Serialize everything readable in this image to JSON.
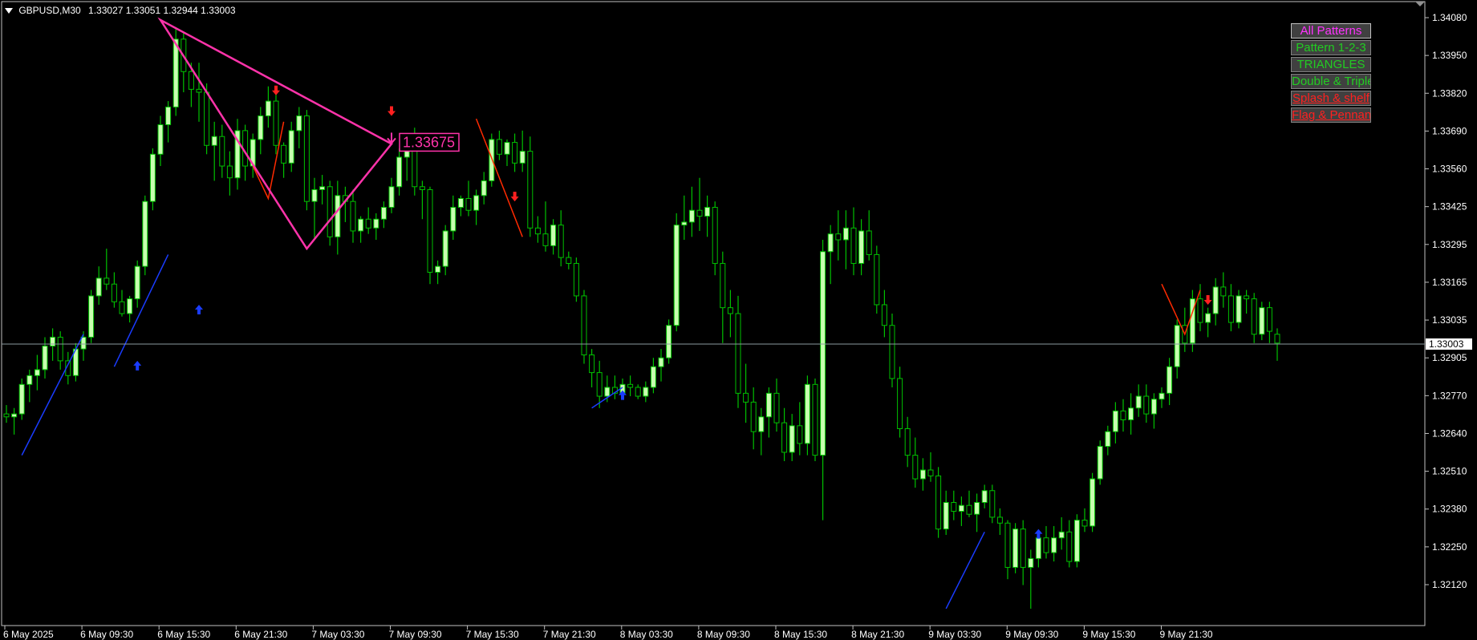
{
  "header": {
    "symbol": "GBPUSD,M30",
    "ohlc": "1.33027 1.33051 1.32944 1.33003"
  },
  "colors": {
    "background": "#000000",
    "axis": "#c0c0c0",
    "wick": "#00c000",
    "bull_body": "#c8ffb0",
    "bear_body": "#000000",
    "pattern": "#ff33aa",
    "zigzag_blue": "#1a3cff",
    "zigzag_red": "#ff2a00",
    "arrow_up": "#1a3cff",
    "arrow_down": "#ff2020",
    "bid_line": "#8c9aa0",
    "button_bg": "#404040"
  },
  "price_axis": {
    "ticks": [
      "1.34080",
      "1.33950",
      "1.33820",
      "1.33690",
      "1.33560",
      "1.33425",
      "1.33295",
      "1.33165",
      "1.33035",
      "1.32905",
      "1.32770",
      "1.32640",
      "1.32510",
      "1.32380",
      "1.32250",
      "1.32120"
    ],
    "current_price": "1.33003"
  },
  "time_axis": {
    "labels": [
      "6 May 2025",
      "6 May 09:30",
      "6 May 15:30",
      "6 May 21:30",
      "7 May 03:30",
      "7 May 09:30",
      "7 May 15:30",
      "7 May 21:30",
      "8 May 03:30",
      "8 May 09:30",
      "8 May 15:30",
      "8 May 21:30",
      "9 May 03:30",
      "9 May 09:30",
      "9 May 15:30",
      "9 May 21:30"
    ]
  },
  "triangle": {
    "label": "1.33675",
    "points": [
      [
        0,
        1.34095
      ],
      [
        19,
        1.3332
      ],
      [
        30,
        1.33675
      ]
    ]
  },
  "panel": {
    "buttons": [
      {
        "label": "All Patterns",
        "color": "#ff33ff",
        "active": true,
        "underline": false
      },
      {
        "label": "Pattern 1-2-3",
        "color": "#22cc22",
        "active": false,
        "underline": false
      },
      {
        "label": "TRIANGLES",
        "color": "#22cc22",
        "active": false,
        "underline": false
      },
      {
        "label": "Double & Triple",
        "color": "#22cc22",
        "active": false,
        "underline": false
      },
      {
        "label": "Splash & shelf",
        "color": "#ff2020",
        "active": false,
        "underline": true
      },
      {
        "label": "Flag & Pennant",
        "color": "#ff2020",
        "active": false,
        "underline": true
      }
    ]
  },
  "chart_data": {
    "type": "candlestick",
    "symbol": "GBPUSD",
    "timeframe": "M30",
    "ylim": [
      1.3207,
      1.3413
    ],
    "candle_start": -20,
    "candles": [
      [
        1.3276,
        1.3279,
        1.3273,
        1.3275
      ],
      [
        1.3275,
        1.3278,
        1.3269,
        1.3276
      ],
      [
        1.3276,
        1.3288,
        1.3274,
        1.3286
      ],
      [
        1.3286,
        1.3291,
        1.328,
        1.3289
      ],
      [
        1.3289,
        1.3296,
        1.3284,
        1.3291
      ],
      [
        1.3291,
        1.3302,
        1.3288,
        1.3299
      ],
      [
        1.3299,
        1.3305,
        1.3294,
        1.3302
      ],
      [
        1.3302,
        1.3304,
        1.3291,
        1.3294
      ],
      [
        1.3294,
        1.3297,
        1.3286,
        1.3289
      ],
      [
        1.3289,
        1.33,
        1.3287,
        1.3298
      ],
      [
        1.3298,
        1.3304,
        1.3294,
        1.3302
      ],
      [
        1.3302,
        1.3318,
        1.33,
        1.3316
      ],
      [
        1.3316,
        1.3326,
        1.3313,
        1.3322
      ],
      [
        1.3322,
        1.3332,
        1.3318,
        1.332
      ],
      [
        1.332,
        1.3324,
        1.3312,
        1.3314
      ],
      [
        1.3314,
        1.3318,
        1.3309,
        1.331
      ],
      [
        1.331,
        1.3316,
        1.3307,
        1.3315
      ],
      [
        1.3315,
        1.3328,
        1.3312,
        1.3326
      ],
      [
        1.3326,
        1.335,
        1.3323,
        1.3348
      ],
      [
        1.3348,
        1.3366,
        1.3345,
        1.3364
      ],
      [
        1.3364,
        1.3377,
        1.336,
        1.3374
      ],
      [
        1.3374,
        1.3382,
        1.3368,
        1.338
      ],
      [
        1.338,
        1.3407,
        1.3377,
        1.3403
      ],
      [
        1.3403,
        1.3405,
        1.3385,
        1.3392
      ],
      [
        1.3392,
        1.3395,
        1.338,
        1.3386
      ],
      [
        1.3386,
        1.3395,
        1.3375,
        1.3385
      ],
      [
        1.3385,
        1.3388,
        1.3364,
        1.3367
      ],
      [
        1.3367,
        1.3375,
        1.3355,
        1.337
      ],
      [
        1.337,
        1.3374,
        1.3356,
        1.336
      ],
      [
        1.336,
        1.3365,
        1.335,
        1.3356
      ],
      [
        1.3356,
        1.3376,
        1.3352,
        1.3372
      ],
      [
        1.3372,
        1.3374,
        1.3355,
        1.336
      ],
      [
        1.336,
        1.3371,
        1.3356,
        1.3369
      ],
      [
        1.3369,
        1.338,
        1.3364,
        1.3377
      ],
      [
        1.3377,
        1.3387,
        1.3373,
        1.3382
      ],
      [
        1.3382,
        1.3385,
        1.3364,
        1.3367
      ],
      [
        1.3367,
        1.3368,
        1.3356,
        1.3361
      ],
      [
        1.3361,
        1.3375,
        1.3358,
        1.3372
      ],
      [
        1.3372,
        1.338,
        1.3366,
        1.3377
      ],
      [
        1.3377,
        1.3379,
        1.3345,
        1.3348
      ],
      [
        1.3348,
        1.3356,
        1.3335,
        1.3352
      ],
      [
        1.3352,
        1.3357,
        1.3347,
        1.3353
      ],
      [
        1.3353,
        1.3355,
        1.3333,
        1.3336
      ],
      [
        1.3336,
        1.3355,
        1.333,
        1.335
      ],
      [
        1.335,
        1.3353,
        1.3341,
        1.3348
      ],
      [
        1.3348,
        1.3352,
        1.3334,
        1.3338
      ],
      [
        1.3338,
        1.3343,
        1.3334,
        1.3342
      ],
      [
        1.3342,
        1.3346,
        1.3337,
        1.3339
      ],
      [
        1.3339,
        1.3344,
        1.3335,
        1.3342
      ],
      [
        1.3342,
        1.3348,
        1.3339,
        1.3346
      ],
      [
        1.3346,
        1.3356,
        1.3344,
        1.3353
      ],
      [
        1.3353,
        1.3366,
        1.335,
        1.3363
      ],
      [
        1.3363,
        1.3368,
        1.3355,
        1.3367
      ],
      [
        1.3367,
        1.3373,
        1.335,
        1.3353
      ],
      [
        1.3353,
        1.3355,
        1.3342,
        1.3352
      ],
      [
        1.3352,
        1.3353,
        1.332,
        1.3324
      ],
      [
        1.3324,
        1.3328,
        1.332,
        1.3326
      ],
      [
        1.3326,
        1.334,
        1.3323,
        1.3338
      ],
      [
        1.3338,
        1.335,
        1.3335,
        1.3346
      ],
      [
        1.3346,
        1.335,
        1.3343,
        1.3349
      ],
      [
        1.3349,
        1.3355,
        1.3343,
        1.3345
      ],
      [
        1.3345,
        1.3352,
        1.334,
        1.335
      ],
      [
        1.335,
        1.3358,
        1.3347,
        1.3355
      ],
      [
        1.3355,
        1.3371,
        1.3353,
        1.3369
      ],
      [
        1.3369,
        1.3372,
        1.3362,
        1.3364
      ],
      [
        1.3364,
        1.3369,
        1.336,
        1.3368
      ],
      [
        1.3368,
        1.3371,
        1.3358,
        1.3361
      ],
      [
        1.3361,
        1.3372,
        1.3358,
        1.3365
      ],
      [
        1.3365,
        1.337,
        1.3336,
        1.3339
      ],
      [
        1.3339,
        1.3343,
        1.3334,
        1.3337
      ],
      [
        1.3337,
        1.3348,
        1.3331,
        1.3333
      ],
      [
        1.3333,
        1.3342,
        1.333,
        1.334
      ],
      [
        1.334,
        1.3345,
        1.3326,
        1.3329
      ],
      [
        1.3329,
        1.3331,
        1.3325,
        1.3327
      ],
      [
        1.3327,
        1.3329,
        1.3314,
        1.3316
      ],
      [
        1.3316,
        1.3318,
        1.3293,
        1.3296
      ],
      [
        1.3296,
        1.3298,
        1.3285,
        1.329
      ],
      [
        1.329,
        1.3294,
        1.3278,
        1.3282
      ],
      [
        1.3282,
        1.3289,
        1.328,
        1.3285
      ],
      [
        1.3285,
        1.3289,
        1.3281,
        1.3283
      ],
      [
        1.3283,
        1.3288,
        1.3281,
        1.3286
      ],
      [
        1.3286,
        1.3289,
        1.3282,
        1.3285
      ],
      [
        1.3285,
        1.3286,
        1.3281,
        1.3282
      ],
      [
        1.3282,
        1.3287,
        1.328,
        1.3285
      ],
      [
        1.3285,
        1.3295,
        1.3283,
        1.3292
      ],
      [
        1.3292,
        1.3298,
        1.3287,
        1.3295
      ],
      [
        1.3295,
        1.3308,
        1.3293,
        1.3306
      ],
      [
        1.3306,
        1.3344,
        1.3304,
        1.334
      ],
      [
        1.334,
        1.335,
        1.3335,
        1.3341
      ],
      [
        1.3341,
        1.3353,
        1.3336,
        1.3345
      ],
      [
        1.3345,
        1.3356,
        1.3338,
        1.3343
      ],
      [
        1.3343,
        1.335,
        1.3336,
        1.3346
      ],
      [
        1.3346,
        1.3348,
        1.3323,
        1.3327
      ],
      [
        1.3327,
        1.3331,
        1.33,
        1.3312
      ],
      [
        1.3312,
        1.3318,
        1.3302,
        1.331
      ],
      [
        1.331,
        1.3316,
        1.3278,
        1.3283
      ],
      [
        1.3283,
        1.3293,
        1.3273,
        1.328
      ],
      [
        1.328,
        1.3285,
        1.3264,
        1.327
      ],
      [
        1.327,
        1.3278,
        1.3262,
        1.3275
      ],
      [
        1.3275,
        1.3285,
        1.3268,
        1.3283
      ],
      [
        1.3283,
        1.3288,
        1.327,
        1.3273
      ],
      [
        1.3273,
        1.3278,
        1.326,
        1.3263
      ],
      [
        1.3263,
        1.3276,
        1.326,
        1.3272
      ],
      [
        1.3272,
        1.328,
        1.3262,
        1.3266
      ],
      [
        1.3266,
        1.3289,
        1.3262,
        1.3286
      ],
      [
        1.3286,
        1.3288,
        1.326,
        1.3262
      ],
      [
        1.3262,
        1.3335,
        1.324,
        1.3331
      ],
      [
        1.3331,
        1.334,
        1.332,
        1.3337
      ],
      [
        1.3337,
        1.3345,
        1.3328,
        1.3335
      ],
      [
        1.3335,
        1.3345,
        1.3325,
        1.3339
      ],
      [
        1.3339,
        1.3346,
        1.3323,
        1.3327
      ],
      [
        1.3327,
        1.3342,
        1.3323,
        1.3338
      ],
      [
        1.3338,
        1.3345,
        1.3328,
        1.333
      ],
      [
        1.333,
        1.3333,
        1.331,
        1.3313
      ],
      [
        1.3313,
        1.3318,
        1.3302,
        1.3306
      ],
      [
        1.3306,
        1.331,
        1.3285,
        1.3288
      ],
      [
        1.3288,
        1.3292,
        1.3268,
        1.3271
      ],
      [
        1.3271,
        1.3275,
        1.3258,
        1.3262
      ],
      [
        1.3262,
        1.3268,
        1.3251,
        1.3254
      ],
      [
        1.3254,
        1.3261,
        1.325,
        1.3257
      ],
      [
        1.3257,
        1.3263,
        1.3253,
        1.3255
      ],
      [
        1.3255,
        1.3258,
        1.3234,
        1.3237
      ],
      [
        1.3237,
        1.325,
        1.3235,
        1.3246
      ],
      [
        1.3246,
        1.325,
        1.324,
        1.3243
      ],
      [
        1.3243,
        1.3248,
        1.3238,
        1.3245
      ],
      [
        1.3245,
        1.325,
        1.3241,
        1.3242
      ],
      [
        1.3242,
        1.3249,
        1.3236,
        1.3246
      ],
      [
        1.3246,
        1.3252,
        1.3244,
        1.325
      ],
      [
        1.325,
        1.3252,
        1.3239,
        1.3241
      ],
      [
        1.3241,
        1.3244,
        1.3235,
        1.3239
      ],
      [
        1.3239,
        1.324,
        1.322,
        1.3224
      ],
      [
        1.3224,
        1.3239,
        1.3222,
        1.3237
      ],
      [
        1.3237,
        1.324,
        1.3218,
        1.3224
      ],
      [
        1.3224,
        1.323,
        1.321,
        1.3227
      ],
      [
        1.3227,
        1.3236,
        1.3224,
        1.3234
      ],
      [
        1.3234,
        1.3238,
        1.3227,
        1.3229
      ],
      [
        1.3229,
        1.3238,
        1.3226,
        1.3234
      ],
      [
        1.3234,
        1.3241,
        1.323,
        1.3236
      ],
      [
        1.3236,
        1.324,
        1.3224,
        1.3226
      ],
      [
        1.3226,
        1.3242,
        1.3224,
        1.324
      ],
      [
        1.324,
        1.3244,
        1.3236,
        1.3238
      ],
      [
        1.3238,
        1.3256,
        1.3236,
        1.3254
      ],
      [
        1.3254,
        1.3267,
        1.3252,
        1.3265
      ],
      [
        1.3265,
        1.3272,
        1.3262,
        1.327
      ],
      [
        1.327,
        1.328,
        1.3266,
        1.3277
      ],
      [
        1.3277,
        1.3281,
        1.327,
        1.3274
      ],
      [
        1.3274,
        1.3283,
        1.3269,
        1.3278
      ],
      [
        1.3278,
        1.3286,
        1.3275,
        1.3282
      ],
      [
        1.3282,
        1.3286,
        1.3273,
        1.3276
      ],
      [
        1.3276,
        1.3283,
        1.3271,
        1.3281
      ],
      [
        1.3281,
        1.3285,
        1.3278,
        1.3283
      ],
      [
        1.3283,
        1.3295,
        1.3279,
        1.3292
      ],
      [
        1.3292,
        1.3308,
        1.3288,
        1.3306
      ],
      [
        1.3306,
        1.3312,
        1.3297,
        1.33
      ],
      [
        1.33,
        1.3318,
        1.3297,
        1.3315
      ],
      [
        1.3315,
        1.332,
        1.3304,
        1.3307
      ],
      [
        1.3307,
        1.3312,
        1.3302,
        1.331
      ],
      [
        1.331,
        1.3322,
        1.3306,
        1.3319
      ],
      [
        1.3319,
        1.3324,
        1.3312,
        1.3316
      ],
      [
        1.3316,
        1.332,
        1.3304,
        1.3307
      ],
      [
        1.3307,
        1.3318,
        1.3305,
        1.3316
      ],
      [
        1.3316,
        1.3318,
        1.331,
        1.3315
      ],
      [
        1.3315,
        1.3317,
        1.33,
        1.3303
      ],
      [
        1.3303,
        1.3314,
        1.3301,
        1.3312
      ],
      [
        1.3312,
        1.3314,
        1.33,
        1.3304
      ],
      [
        1.3303,
        1.3305,
        1.3294,
        1.33
      ]
    ]
  },
  "arrows": [
    {
      "dir": "up",
      "bar": -3,
      "price": 1.3294
    },
    {
      "dir": "up",
      "bar": 5,
      "price": 1.3313
    },
    {
      "dir": "down",
      "bar": 15,
      "price": 1.3384
    },
    {
      "dir": "down",
      "bar": 30,
      "price": 1.3377
    },
    {
      "dir": "down",
      "bar": 46,
      "price": 1.3348
    },
    {
      "dir": "up",
      "bar": 60,
      "price": 1.3284
    },
    {
      "dir": "up",
      "bar": 114,
      "price": 1.3237
    },
    {
      "dir": "down",
      "bar": 136,
      "price": 1.3313
    }
  ],
  "zigzags": [
    {
      "color": "blue",
      "points": [
        [
          -18,
          1.3262
        ],
        [
          -10,
          1.3303
        ]
      ]
    },
    {
      "color": "blue",
      "points": [
        [
          -6,
          1.3292
        ],
        [
          1,
          1.333
        ]
      ]
    },
    {
      "color": "red",
      "points": [
        [
          12,
          1.336
        ],
        [
          14,
          1.3349
        ],
        [
          16,
          1.3375
        ]
      ]
    },
    {
      "color": "red",
      "points": [
        [
          41,
          1.3376
        ],
        [
          47,
          1.3336
        ]
      ]
    },
    {
      "color": "blue",
      "points": [
        [
          56,
          1.3278
        ],
        [
          60,
          1.3285
        ]
      ]
    },
    {
      "color": "blue",
      "points": [
        [
          102,
          1.321
        ],
        [
          107,
          1.3236
        ]
      ]
    },
    {
      "color": "red",
      "points": [
        [
          130,
          1.332
        ],
        [
          133,
          1.3303
        ],
        [
          135,
          1.3318
        ]
      ]
    }
  ]
}
